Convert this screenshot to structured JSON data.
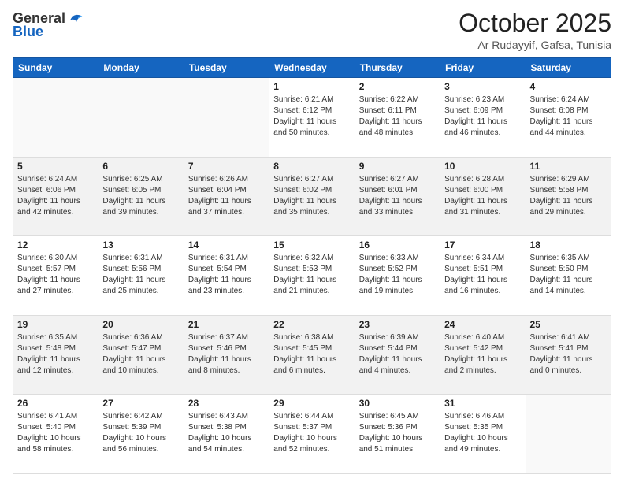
{
  "header": {
    "logo_general": "General",
    "logo_blue": "Blue",
    "month": "October 2025",
    "location": "Ar Rudayyif, Gafsa, Tunisia"
  },
  "weekdays": [
    "Sunday",
    "Monday",
    "Tuesday",
    "Wednesday",
    "Thursday",
    "Friday",
    "Saturday"
  ],
  "weeks": [
    [
      {
        "day": "",
        "info": ""
      },
      {
        "day": "",
        "info": ""
      },
      {
        "day": "",
        "info": ""
      },
      {
        "day": "1",
        "info": "Sunrise: 6:21 AM\nSunset: 6:12 PM\nDaylight: 11 hours\nand 50 minutes."
      },
      {
        "day": "2",
        "info": "Sunrise: 6:22 AM\nSunset: 6:11 PM\nDaylight: 11 hours\nand 48 minutes."
      },
      {
        "day": "3",
        "info": "Sunrise: 6:23 AM\nSunset: 6:09 PM\nDaylight: 11 hours\nand 46 minutes."
      },
      {
        "day": "4",
        "info": "Sunrise: 6:24 AM\nSunset: 6:08 PM\nDaylight: 11 hours\nand 44 minutes."
      }
    ],
    [
      {
        "day": "5",
        "info": "Sunrise: 6:24 AM\nSunset: 6:06 PM\nDaylight: 11 hours\nand 42 minutes."
      },
      {
        "day": "6",
        "info": "Sunrise: 6:25 AM\nSunset: 6:05 PM\nDaylight: 11 hours\nand 39 minutes."
      },
      {
        "day": "7",
        "info": "Sunrise: 6:26 AM\nSunset: 6:04 PM\nDaylight: 11 hours\nand 37 minutes."
      },
      {
        "day": "8",
        "info": "Sunrise: 6:27 AM\nSunset: 6:02 PM\nDaylight: 11 hours\nand 35 minutes."
      },
      {
        "day": "9",
        "info": "Sunrise: 6:27 AM\nSunset: 6:01 PM\nDaylight: 11 hours\nand 33 minutes."
      },
      {
        "day": "10",
        "info": "Sunrise: 6:28 AM\nSunset: 6:00 PM\nDaylight: 11 hours\nand 31 minutes."
      },
      {
        "day": "11",
        "info": "Sunrise: 6:29 AM\nSunset: 5:58 PM\nDaylight: 11 hours\nand 29 minutes."
      }
    ],
    [
      {
        "day": "12",
        "info": "Sunrise: 6:30 AM\nSunset: 5:57 PM\nDaylight: 11 hours\nand 27 minutes."
      },
      {
        "day": "13",
        "info": "Sunrise: 6:31 AM\nSunset: 5:56 PM\nDaylight: 11 hours\nand 25 minutes."
      },
      {
        "day": "14",
        "info": "Sunrise: 6:31 AM\nSunset: 5:54 PM\nDaylight: 11 hours\nand 23 minutes."
      },
      {
        "day": "15",
        "info": "Sunrise: 6:32 AM\nSunset: 5:53 PM\nDaylight: 11 hours\nand 21 minutes."
      },
      {
        "day": "16",
        "info": "Sunrise: 6:33 AM\nSunset: 5:52 PM\nDaylight: 11 hours\nand 19 minutes."
      },
      {
        "day": "17",
        "info": "Sunrise: 6:34 AM\nSunset: 5:51 PM\nDaylight: 11 hours\nand 16 minutes."
      },
      {
        "day": "18",
        "info": "Sunrise: 6:35 AM\nSunset: 5:50 PM\nDaylight: 11 hours\nand 14 minutes."
      }
    ],
    [
      {
        "day": "19",
        "info": "Sunrise: 6:35 AM\nSunset: 5:48 PM\nDaylight: 11 hours\nand 12 minutes."
      },
      {
        "day": "20",
        "info": "Sunrise: 6:36 AM\nSunset: 5:47 PM\nDaylight: 11 hours\nand 10 minutes."
      },
      {
        "day": "21",
        "info": "Sunrise: 6:37 AM\nSunset: 5:46 PM\nDaylight: 11 hours\nand 8 minutes."
      },
      {
        "day": "22",
        "info": "Sunrise: 6:38 AM\nSunset: 5:45 PM\nDaylight: 11 hours\nand 6 minutes."
      },
      {
        "day": "23",
        "info": "Sunrise: 6:39 AM\nSunset: 5:44 PM\nDaylight: 11 hours\nand 4 minutes."
      },
      {
        "day": "24",
        "info": "Sunrise: 6:40 AM\nSunset: 5:42 PM\nDaylight: 11 hours\nand 2 minutes."
      },
      {
        "day": "25",
        "info": "Sunrise: 6:41 AM\nSunset: 5:41 PM\nDaylight: 11 hours\nand 0 minutes."
      }
    ],
    [
      {
        "day": "26",
        "info": "Sunrise: 6:41 AM\nSunset: 5:40 PM\nDaylight: 10 hours\nand 58 minutes."
      },
      {
        "day": "27",
        "info": "Sunrise: 6:42 AM\nSunset: 5:39 PM\nDaylight: 10 hours\nand 56 minutes."
      },
      {
        "day": "28",
        "info": "Sunrise: 6:43 AM\nSunset: 5:38 PM\nDaylight: 10 hours\nand 54 minutes."
      },
      {
        "day": "29",
        "info": "Sunrise: 6:44 AM\nSunset: 5:37 PM\nDaylight: 10 hours\nand 52 minutes."
      },
      {
        "day": "30",
        "info": "Sunrise: 6:45 AM\nSunset: 5:36 PM\nDaylight: 10 hours\nand 51 minutes."
      },
      {
        "day": "31",
        "info": "Sunrise: 6:46 AM\nSunset: 5:35 PM\nDaylight: 10 hours\nand 49 minutes."
      },
      {
        "day": "",
        "info": ""
      }
    ]
  ]
}
